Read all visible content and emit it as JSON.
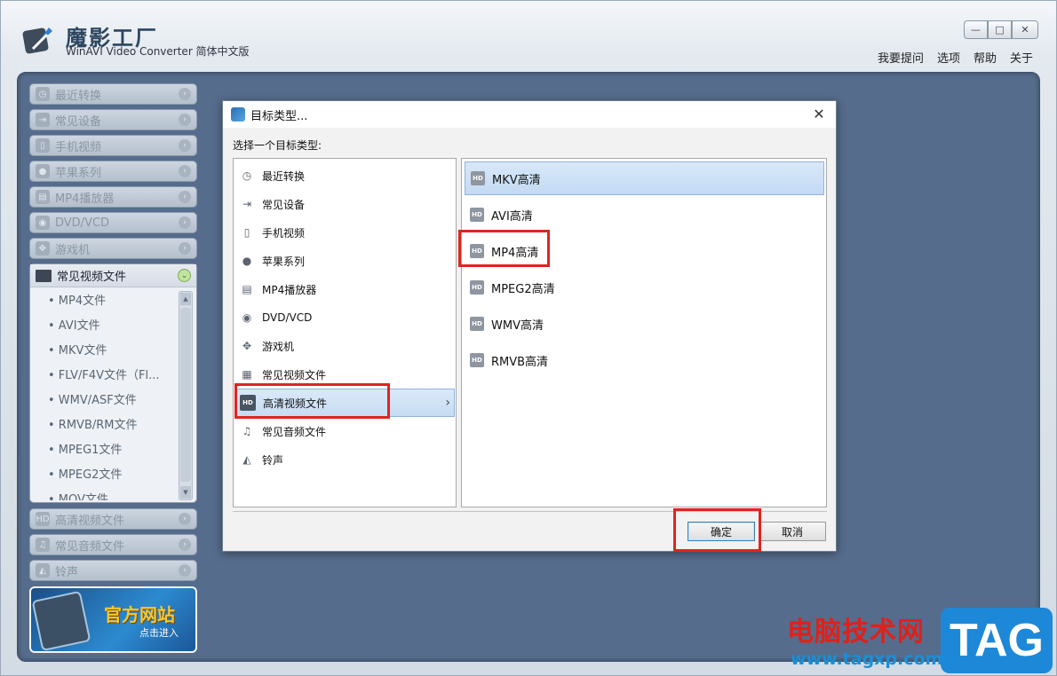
{
  "app": {
    "title": "魔影工厂",
    "subtitle": "WinAVI Video Converter 简体中文版",
    "window_controls": [
      "—",
      "□",
      "✕"
    ],
    "top_links": [
      "我要提问",
      "选项",
      "帮助",
      "关于"
    ]
  },
  "sidebar": {
    "items_top": [
      {
        "label": "最近转换",
        "icon": "clock-icon"
      },
      {
        "label": "常见设备",
        "icon": "device-icon"
      },
      {
        "label": "手机视频",
        "icon": "phone-icon"
      },
      {
        "label": "苹果系列",
        "icon": "apple-icon"
      },
      {
        "label": "MP4播放器",
        "icon": "mp4-player-icon"
      },
      {
        "label": "DVD/VCD",
        "icon": "disc-icon"
      },
      {
        "label": "游戏机",
        "icon": "gamepad-icon"
      }
    ],
    "open_group": {
      "label": "常见视频文件",
      "items": [
        "• MP4文件",
        "• AVI文件",
        "• MKV文件",
        "• FLV/F4V文件（Fl...",
        "• WMV/ASF文件",
        "• RMVB/RM文件",
        "• MPEG1文件",
        "• MPEG2文件",
        "• MOV文件"
      ]
    },
    "items_bottom": [
      {
        "label": "高清视频文件",
        "icon": "hd-icon"
      },
      {
        "label": "常见音频文件",
        "icon": "music-icon"
      },
      {
        "label": "铃声",
        "icon": "bell-icon"
      }
    ],
    "banner": {
      "title": "官方网站",
      "subtitle": "点击进入"
    }
  },
  "dialog": {
    "title": "目标类型...",
    "prompt": "选择一个目标类型:",
    "left_list": [
      {
        "label": "最近转换",
        "icon": "clock-icon",
        "glyph": "◷"
      },
      {
        "label": "常见设备",
        "icon": "device-icon",
        "glyph": "⇥"
      },
      {
        "label": "手机视频",
        "icon": "phone-icon",
        "glyph": "▯"
      },
      {
        "label": "苹果系列",
        "icon": "apple-icon",
        "glyph": "●"
      },
      {
        "label": "MP4播放器",
        "icon": "mp4-player-icon",
        "glyph": "▤"
      },
      {
        "label": "DVD/VCD",
        "icon": "disc-icon",
        "glyph": "◉"
      },
      {
        "label": "游戏机",
        "icon": "gamepad-icon",
        "glyph": "✥"
      },
      {
        "label": "常见视频文件",
        "icon": "film-icon",
        "glyph": "▦"
      },
      {
        "label": "高清视频文件",
        "icon": "hd-icon",
        "glyph": "HD",
        "selected": true
      },
      {
        "label": "常见音频文件",
        "icon": "music-icon",
        "glyph": "♫"
      },
      {
        "label": "铃声",
        "icon": "bell-icon",
        "glyph": "◭"
      }
    ],
    "right_list": [
      {
        "label": "MKV高清",
        "selected": true
      },
      {
        "label": "AVI高清"
      },
      {
        "label": "MP4高清"
      },
      {
        "label": "MPEG2高清"
      },
      {
        "label": "WMV高清"
      },
      {
        "label": "RMVB高清"
      }
    ],
    "ok_label": "确定",
    "cancel_label": "取消",
    "close_glyph": "✕",
    "chevron_glyph": "›",
    "hd_glyph": "HD"
  },
  "watermark": {
    "text": "电脑技术网",
    "url": "www.tagxp.com",
    "tag": "TAG"
  },
  "colors": {
    "highlight": "#e0241e",
    "main_bg": "#566c8c",
    "selection": "#c6dcf3"
  }
}
